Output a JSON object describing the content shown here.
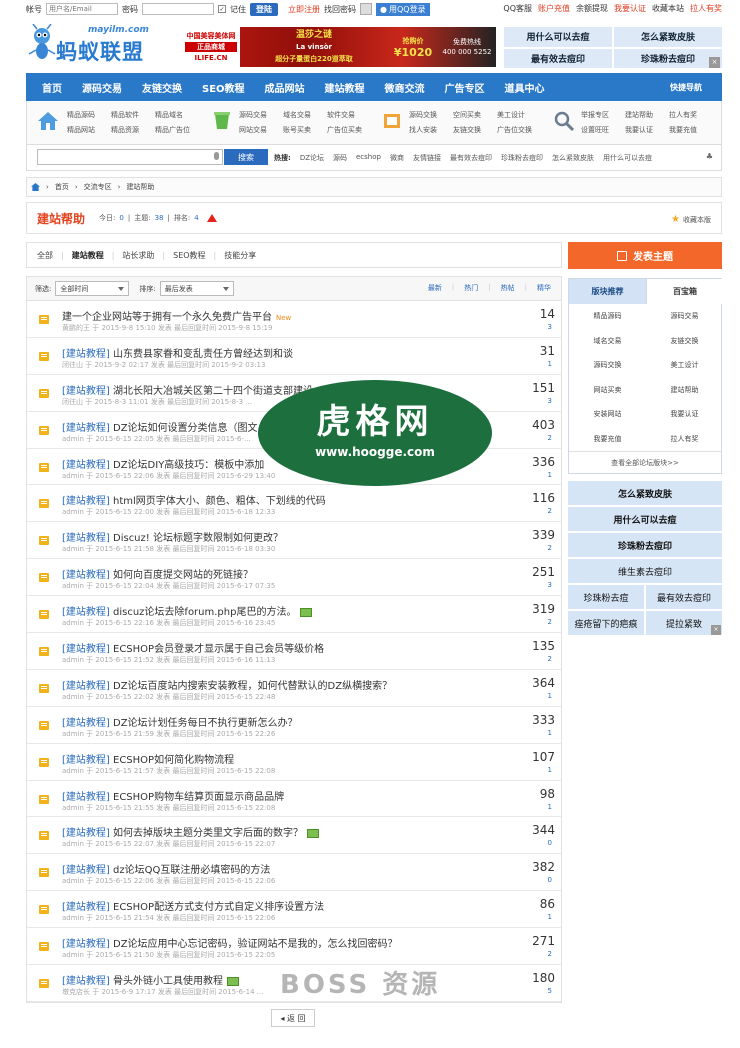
{
  "topbar": {
    "account_label": "帐号",
    "account_placeholder": "用户名/Email",
    "password_label": "密码",
    "remember_label": "记住",
    "login_button": "登陆",
    "register_link": "立即注册",
    "forgot_link": "找回密码",
    "qq_login": "用QQ登录",
    "right_links": [
      "QQ客服",
      "账户充值",
      "余额提现",
      "我要认证",
      "收藏本站",
      "拉人有奖"
    ]
  },
  "header": {
    "logo_domain": "mayilm.com",
    "logo_name": "蚂蚁联盟",
    "banner": {
      "left_top": "中国美容美体网",
      "left_mid": "正品商城",
      "left_bottom": "ILIFE.CN",
      "center_line1": "温莎之谜",
      "center_line2": "La vinsòr",
      "center_line3": "超分子量蛋白220道萃取",
      "price_label": "抢购价",
      "price": "¥1020",
      "hotline_label": "免费热线",
      "hotline": "400 000 5252"
    },
    "ads": [
      "用什么可以去痘",
      "怎么紧致皮肤",
      "最有效去痘印",
      "珍珠粉去痘印"
    ]
  },
  "nav": {
    "items": [
      "首页",
      "源码交易",
      "友链交换",
      "SEO教程",
      "成品网站",
      "建站教程",
      "微商交流",
      "广告专区",
      "道具中心"
    ],
    "quick": "快捷导航"
  },
  "subnav": {
    "group1": [
      "精品源码",
      "精品软件",
      "精品域名",
      "精品网站",
      "精品资源",
      "精品广告位"
    ],
    "group2": [
      "源码交易",
      "域名交易",
      "软件交易",
      "网站交易",
      "账号买卖",
      "广告位买卖"
    ],
    "group3": [
      "源码交换",
      "空间买卖",
      "美工设计",
      "找人安装",
      "友链交换",
      "广告位交换"
    ],
    "group4": [
      "举报专区",
      "建站帮助",
      "拉人有奖",
      "设置旺旺",
      "我要认证",
      "我要充值"
    ]
  },
  "search": {
    "button": "搜索",
    "hot_label": "热搜:",
    "hot": [
      "DZ论坛",
      "源码",
      "ecshop",
      "微商",
      "友情链接",
      "最有效去痘印",
      "珍珠粉去痘印",
      "怎么紧致皮肤",
      "用什么可以去痘"
    ]
  },
  "breadcrumb": [
    "首页",
    "交流专区",
    "建站帮助"
  ],
  "forum": {
    "title": "建站帮助",
    "today_label": "今日:",
    "today": "0",
    "topics_label": "主题:",
    "topics": "38",
    "rank_label": "排名:",
    "rank": "4",
    "fav": "收藏本版"
  },
  "tabs": [
    "全部",
    "建站教程",
    "站长求助",
    "SEO教程",
    "技能分享"
  ],
  "filters": {
    "filter_label": "筛选:",
    "time_select": "全部时间",
    "sort_label": "排序:",
    "sort_select": "最后发表",
    "sorts": [
      "最新",
      "热门",
      "热帖",
      "精华"
    ]
  },
  "threads": [
    {
      "cat": "",
      "title": "建一个企业网站等于拥有一个永久免费广告平台",
      "new": "New",
      "pic": false,
      "meta": "黄鹏的王 于 2015-9-8 15:10 发表 最后回复时间 2015-9-8 15:19",
      "replies": "14",
      "views": "3"
    },
    {
      "cat": "[建站教程]",
      "title": "山东费县家眷和变乱责任方曾经达到和谈",
      "new": "",
      "pic": false,
      "meta": "闭往山 于 2015-9-2 02:17 发表 最后回复时间 2015-9-2 03:13",
      "replies": "31",
      "views": "1"
    },
    {
      "cat": "[建站教程]",
      "title": "湖北长阳大冶城关区第二十四个街道支部建设",
      "new": "",
      "pic": false,
      "meta": "闭往山 于 2015-8-3 11:01 发表 最后回复时间 2015-8-3 ...",
      "replies": "151",
      "views": "3"
    },
    {
      "cat": "[建站教程]",
      "title": "DZ论坛如何设置分类信息（图文",
      "new": "",
      "pic": false,
      "meta": "admin 于 2015-6-15 22:05 发表 最后回复时间 2015-6-...",
      "replies": "403",
      "views": "2"
    },
    {
      "cat": "[建站教程]",
      "title": "DZ论坛DIY高级技巧：模板中添加",
      "new": "",
      "pic": false,
      "meta": "admin 于 2015-6-15 22:06 发表 最后回复时间 2015-6-29 13:40",
      "replies": "336",
      "views": "1"
    },
    {
      "cat": "[建站教程]",
      "title": "html网页字体大小、颜色、粗体、下划线的代码",
      "new": "",
      "pic": false,
      "meta": "admin 于 2015-6-15 22:00 发表 最后回复时间 2015-6-18 12:33",
      "replies": "116",
      "views": "2"
    },
    {
      "cat": "[建站教程]",
      "title": "Discuz! 论坛标题字数限制如何更改？",
      "new": "",
      "pic": false,
      "meta": "admin 于 2015-6-15 21:58 发表 最后回复时间 2015-6-18 03:30",
      "replies": "339",
      "views": "2"
    },
    {
      "cat": "[建站教程]",
      "title": "如何向百度提交网站的死链接？",
      "new": "",
      "pic": false,
      "meta": "admin 于 2015-6-15 22:04 发表 最后回复时间 2015-6-17 07:35",
      "replies": "251",
      "views": "3"
    },
    {
      "cat": "[建站教程]",
      "title": "discuz论坛去除forum.php尾巴的方法。",
      "new": "",
      "pic": true,
      "meta": "admin 于 2015-6-15 22:16 发表 最后回复时间 2015-6-16 23:45",
      "replies": "319",
      "views": "2"
    },
    {
      "cat": "[建站教程]",
      "title": "ECSHOP会员登录才显示属于自己会员等级价格",
      "new": "",
      "pic": false,
      "meta": "admin 于 2015-6-15 21:52 发表 最后回复时间 2015-6-16 11:13",
      "replies": "135",
      "views": "2"
    },
    {
      "cat": "[建站教程]",
      "title": "DZ论坛百度站内搜索安装教程，如何代替默认的DZ纵横搜索？",
      "new": "",
      "pic": false,
      "meta": "admin 于 2015-6-15 22:02 发表 最后回复时间 2015-6-15 22:48",
      "replies": "364",
      "views": "1"
    },
    {
      "cat": "[建站教程]",
      "title": "DZ论坛计划任务每日不执行更新怎么办？",
      "new": "",
      "pic": false,
      "meta": "admin 于 2015-6-15 21:59 发表 最后回复时间 2015-6-15 22:26",
      "replies": "333",
      "views": "1"
    },
    {
      "cat": "[建站教程]",
      "title": "ECSHOP如何简化购物流程",
      "new": "",
      "pic": false,
      "meta": "admin 于 2015-6-15 21:57 发表 最后回复时间 2015-6-15 22:08",
      "replies": "107",
      "views": "1"
    },
    {
      "cat": "[建站教程]",
      "title": "ECSHOP购物车结算页面显示商品品牌",
      "new": "",
      "pic": false,
      "meta": "admin 于 2015-6-15 21:55 发表 最后回复时间 2015-6-15 22:08",
      "replies": "98",
      "views": "1"
    },
    {
      "cat": "[建站教程]",
      "title": "如何去掉版块主题分类里文字后面的数字？",
      "new": "",
      "pic": true,
      "meta": "admin 于 2015-6-15 22:07 发表 最后回复时间 2015-6-15 22:07",
      "replies": "344",
      "views": "0"
    },
    {
      "cat": "[建站教程]",
      "title": "dz论坛QQ互联注册必填密码的方法",
      "new": "",
      "pic": false,
      "meta": "admin 于 2015-6-15 22:06 发表 最后回复时间 2015-6-15 22:06",
      "replies": "382",
      "views": "0"
    },
    {
      "cat": "[建站教程]",
      "title": "ECSHOP配送方式支付方式自定义排序设置方法",
      "new": "",
      "pic": false,
      "meta": "admin 于 2015-6-15 21:54 发表 最后回复时间 2015-6-15 22:06",
      "replies": "86",
      "views": "1"
    },
    {
      "cat": "[建站教程]",
      "title": "DZ论坛应用中心忘记密码，验证网站不是我的，怎么找回密码？",
      "new": "",
      "pic": false,
      "meta": "admin 于 2015-6-15 21:50 发表 最后回复时间 2015-6-15 22:05",
      "replies": "271",
      "views": "2"
    },
    {
      "cat": "[建站教程]",
      "title": "骨头外链小工具使用教程",
      "new": "",
      "pic": true,
      "meta": "墩克店长 于 2015-6-9 17:17 发表 最后回复时间 2015-6-14 ...",
      "replies": "180",
      "views": "5"
    }
  ],
  "back": "◂ 返 回",
  "sidebar": {
    "post_button": "发表主题",
    "tab_active": "版块推荐",
    "tab_other": "百宝箱",
    "links": [
      "精品源码",
      "源码交易",
      "域名交易",
      "友链交换",
      "源码交换",
      "美工设计",
      "网站买卖",
      "建站帮助",
      "安装网站",
      "我要认证",
      "我要充值",
      "拉人有奖"
    ],
    "more": "查看全部论坛版块>>",
    "ads": [
      "怎么紧致皮肤",
      "用什么可以去痘",
      "珍珠粉去痘印",
      "维生素去痘印",
      "珍珠粉去痘",
      "最有效去痘印",
      "痤疮留下的疤痕",
      "提拉紧致"
    ]
  },
  "watermark": {
    "cn": "虎格网",
    "en": "www.hoogge.com",
    "bottom": "BOSS 资源"
  }
}
